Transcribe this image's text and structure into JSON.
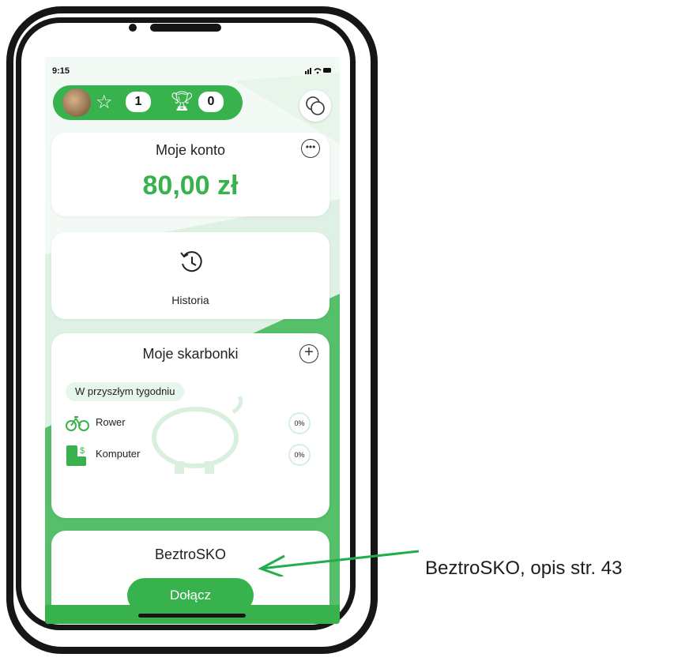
{
  "colors": {
    "accent": "#37b24d",
    "accent_light": "#e6f6ea",
    "frame": "#161616"
  },
  "status_bar": {
    "time": "9:15",
    "icons": "signal-wifi-battery"
  },
  "header": {
    "stars_count": "1",
    "trophies_count": "0",
    "icons": [
      "avatar",
      "star-icon",
      "trophy-icon",
      "chat-icon"
    ]
  },
  "account": {
    "title": "Moje konto",
    "amount": "80,00 zł"
  },
  "history": {
    "label": "Historia"
  },
  "piggy_banks": {
    "title": "Moje skarbonki",
    "chip": "W przyszłym tygodniu",
    "goals": [
      {
        "label": "Rower",
        "progress": "0%",
        "icon": "bike-icon"
      },
      {
        "label": "Komputer",
        "progress": "0%",
        "icon": "coins-icon"
      }
    ]
  },
  "beztrosko": {
    "title": "BeztroSKO",
    "button": "Dołącz"
  },
  "annotation": {
    "text": "BeztroSKO, opis str. 43"
  }
}
